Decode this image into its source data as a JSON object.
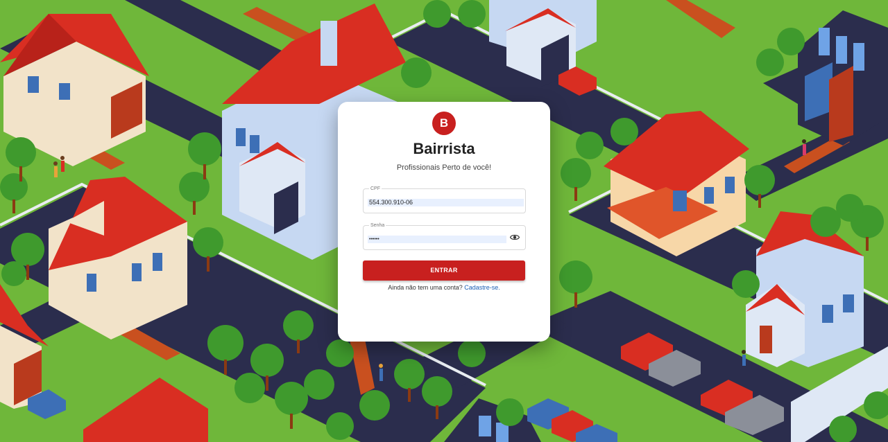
{
  "app": {
    "logo_letter": "B",
    "name": "Bairrista",
    "tagline": "Profissionais Perto de você!"
  },
  "form": {
    "cpf": {
      "label": "CPF",
      "value": "554.300.910-06"
    },
    "senha": {
      "label": "Senha",
      "value": "••••••"
    },
    "submit_label": "ENTRAR",
    "signup_prompt": "Ainda não tem uma conta?",
    "signup_link": "Cadastre-se."
  },
  "icons": {
    "password_toggle": "eye-icon"
  },
  "colors": {
    "brand_red": "#c8201f",
    "link_blue": "#1a5fb4",
    "autofill_bg": "#e8f0fe"
  }
}
